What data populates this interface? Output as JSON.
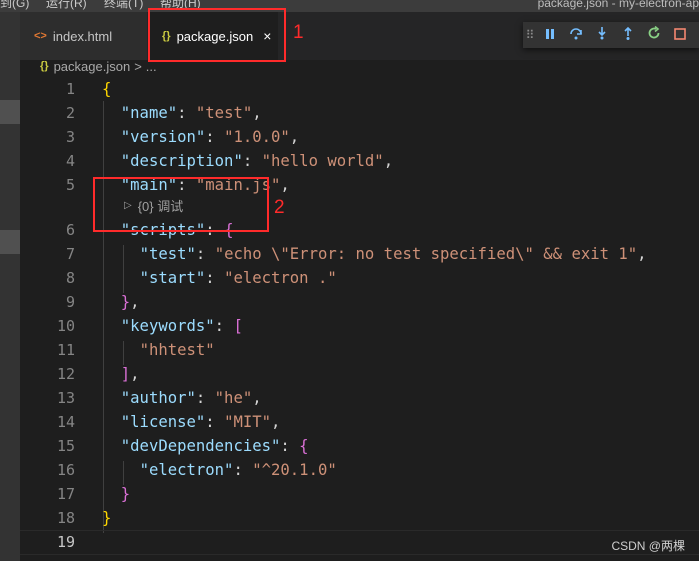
{
  "menubar": {
    "items": [
      "到(G)",
      "运行(R)",
      "终端(T)",
      "帮助(H)"
    ],
    "window_title": "package.json - my-electron-ap"
  },
  "tabs": [
    {
      "label": "index.html",
      "icon": "<>",
      "active": false
    },
    {
      "label": "package.json",
      "icon": "{}",
      "active": true,
      "close": "×"
    }
  ],
  "debug_toolbar": {
    "buttons": [
      "grip",
      "pause",
      "step-over",
      "step-into",
      "step-out",
      "restart",
      "stop"
    ]
  },
  "breadcrumb": {
    "icon": "{}",
    "file": "package.json",
    "separator": ">",
    "more": "..."
  },
  "editor": {
    "line_numbers": [
      "1",
      "2",
      "3",
      "4",
      "5",
      "6",
      "7",
      "8",
      "9",
      "10",
      "11",
      "12",
      "13",
      "14",
      "15",
      "16",
      "17",
      "18",
      "19"
    ],
    "codelens": {
      "icon": "▷",
      "label": "{0} 调试"
    },
    "code": {
      "open_brace": "{",
      "name_key": "\"name\"",
      "name_val": "\"test\"",
      "version_key": "\"version\"",
      "version_val": "\"1.0.0\"",
      "description_key": "\"description\"",
      "description_val": "\"hello world\"",
      "main_key": "\"main\"",
      "main_val": "\"main.js\"",
      "scripts_key": "\"scripts\"",
      "test_key": "\"test\"",
      "test_val": "\"echo \\\"Error: no test specified\\\" && exit 1\"",
      "start_key": "\"start\"",
      "start_val": "\"electron .\"",
      "keywords_key": "\"keywords\"",
      "keywords_item": "\"hhtest\"",
      "author_key": "\"author\"",
      "author_val": "\"he\"",
      "license_key": "\"license\"",
      "license_val": "\"MIT\"",
      "devdeps_key": "\"devDependencies\"",
      "electron_key": "\"electron\"",
      "electron_val": "\"^20.1.0\"",
      "close_brace": "}"
    }
  },
  "annotations": {
    "label1": "1",
    "label2": "2"
  },
  "watermark": "CSDN @两棵",
  "colors": {
    "annotation_red": "#ff2b2b",
    "json_key": "#9cdcfe",
    "json_string": "#ce9178"
  }
}
